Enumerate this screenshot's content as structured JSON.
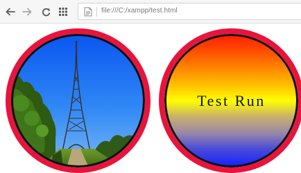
{
  "browser": {
    "address": "file:///C:/xampp/test.html",
    "back_icon": "back-arrow-icon",
    "forward_icon": "forward-arrow-icon",
    "reload_icon": "reload-icon",
    "apps_icon": "apps-grid-icon",
    "page_icon": "page-icon"
  },
  "main": {
    "photo_circle": {
      "image_subject": "Eiffel Tower landmark photo",
      "border_color": "#e8143c"
    },
    "gradient_circle": {
      "label": "Test Run",
      "border_color": "#e8143c",
      "gradient_colors": [
        "#ff1a00",
        "#ffff00",
        "#1020ff"
      ]
    }
  }
}
